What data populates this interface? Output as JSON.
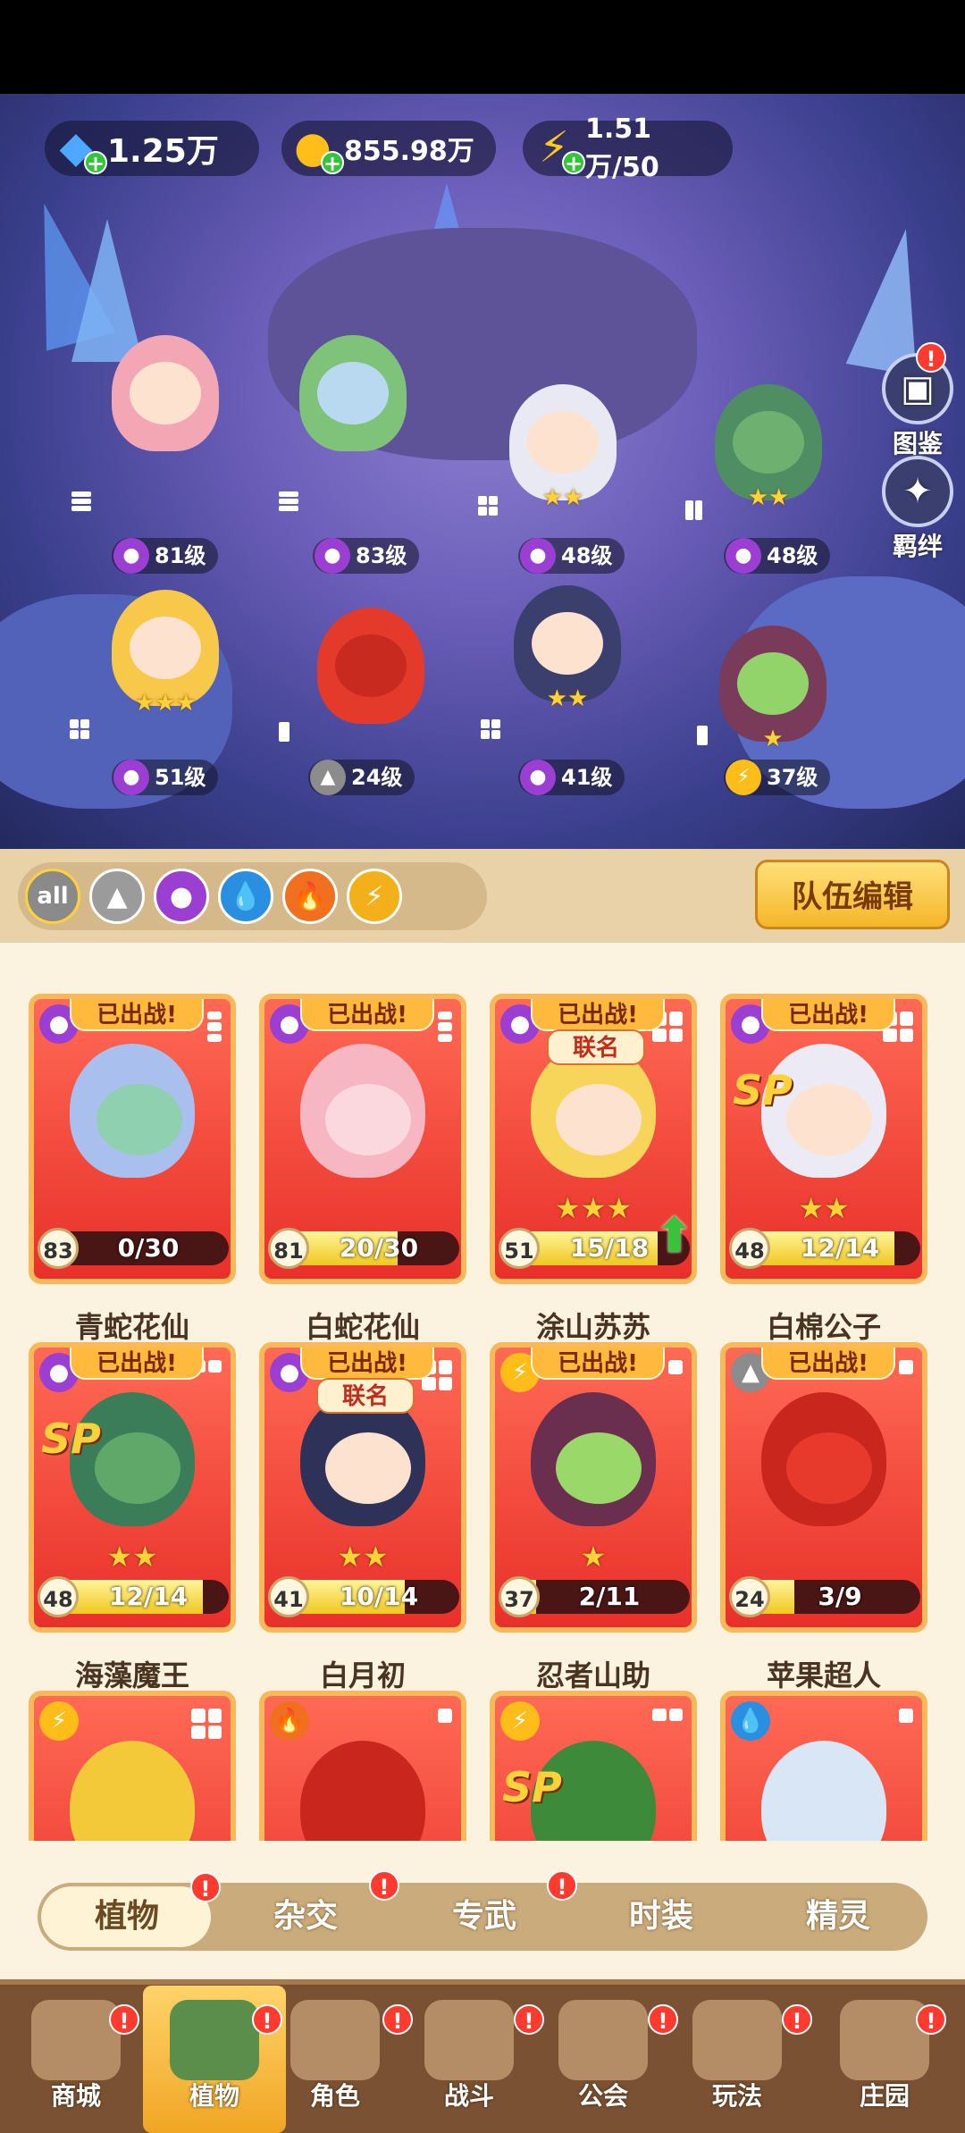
{
  "resources": {
    "gems": "1.25万",
    "coins": "855.98万",
    "energy": "1.51万/50"
  },
  "side_buttons": {
    "collection": "图鉴",
    "bonds": "羁绊"
  },
  "formation": [
    {
      "level": "81级",
      "stars": ""
    },
    {
      "level": "83级",
      "stars": ""
    },
    {
      "level": "48级",
      "stars": "★★"
    },
    {
      "level": "48级",
      "stars": "★★"
    },
    {
      "level": "51级",
      "stars": "★★★"
    },
    {
      "level": "24级",
      "stars": ""
    },
    {
      "level": "41级",
      "stars": "★★"
    },
    {
      "level": "37级",
      "stars": "★"
    }
  ],
  "filters": {
    "all": "all"
  },
  "team_edit_button": "队伍编辑",
  "deployed_label": "已出战!",
  "linkage_label": "联名",
  "sp_label": "SP",
  "cards": [
    {
      "name": "青蛇花仙",
      "level": "83",
      "progress": "0/30",
      "fill": 0,
      "stars": ""
    },
    {
      "name": "白蛇花仙",
      "level": "81",
      "progress": "20/30",
      "fill": 0.67,
      "stars": ""
    },
    {
      "name": "涂山苏苏",
      "level": "51",
      "progress": "15/18",
      "fill": 0.83,
      "stars": "★★★"
    },
    {
      "name": "白棉公子",
      "level": "48",
      "progress": "12/14",
      "fill": 0.86,
      "stars": "★★"
    },
    {
      "name": "海藻魔王",
      "level": "48",
      "progress": "12/14",
      "fill": 0.86,
      "stars": "★★"
    },
    {
      "name": "白月初",
      "level": "41",
      "progress": "10/14",
      "fill": 0.71,
      "stars": "★★"
    },
    {
      "name": "忍者山助",
      "level": "37",
      "progress": "2/11",
      "fill": 0.18,
      "stars": "★"
    },
    {
      "name": "苹果超人",
      "level": "24",
      "progress": "3/9",
      "fill": 0.33,
      "stars": ""
    }
  ],
  "sub_tabs": [
    "植物",
    "杂交",
    "专武",
    "时装",
    "精灵"
  ],
  "nav": [
    "商城",
    "植物",
    "角色",
    "战斗",
    "公会",
    "玩法",
    "庄园"
  ],
  "badge": "!"
}
